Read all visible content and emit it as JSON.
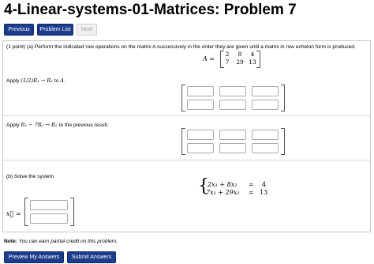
{
  "title": "4-Linear-systems-01-Matrices: Problem 7",
  "nav": {
    "previous": "Previous",
    "problem_list": "Problem List",
    "next": "Next"
  },
  "problem": {
    "intro": "(1 point) (a) Perform the indicated row operations on the matrix A successively in the order they are given until a matrix in row echelon form is produced.",
    "matrix_label": "A =",
    "matrix": [
      [
        "2",
        "8",
        "4"
      ],
      [
        "7",
        "29",
        "13"
      ]
    ],
    "step1": {
      "prefix": "Apply ",
      "op": "(1/2)R₁ → R₁",
      "mid": " to ",
      "target": "A",
      "suffix": "."
    },
    "step2": {
      "prefix": "Apply ",
      "op": "R₂ − 7R₁ → R₂",
      "suffix": " to the previous result."
    },
    "part_b": "(b) Solve the system",
    "system": [
      {
        "lhs": "2x₁ + 8x₂",
        "eq": "=",
        "rhs": "4"
      },
      {
        "lhs": "7x₁ + 29x₂",
        "eq": "=",
        "rhs": "13"
      }
    ],
    "vector_label": "x⃗ ="
  },
  "note": {
    "label": "Note:",
    "text": " You can earn partial credit on this problem."
  },
  "buttons": {
    "preview": "Preview My Answers",
    "submit": "Submit Answers"
  },
  "colors": {
    "button_blue": "#1c3c8c",
    "disabled_gray": "#f0f0f0"
  }
}
